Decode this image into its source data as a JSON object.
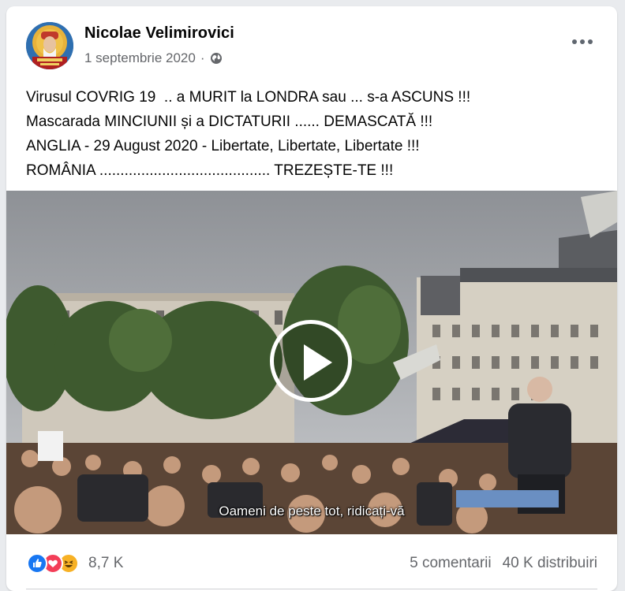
{
  "post": {
    "author": "Nicolae Velimirovici",
    "date": "1 septembrie 2020",
    "separator": "·",
    "privacy_icon": "globe-icon",
    "more_icon": "more-options-icon",
    "lines": [
      "Virusul COVRIG 19  .. a MURIT la LONDRA sau ... s-a ASCUNS !!!",
      "Mascarada MINCIUNII și a DICTATURII ...... DEMASCATĂ !!!",
      "ANGLIA - 29 August 2020 - Libertate, Libertate, Libertate !!!",
      "ROMÂNIA ......................................... TREZEȘTE-TE !!!"
    ]
  },
  "video": {
    "caption": "Oameni de peste tot, ridicați-vă",
    "play_icon": "play-icon"
  },
  "footer": {
    "reaction_icons": [
      "like-icon",
      "love-icon",
      "haha-icon"
    ],
    "reaction_count": "8,7 K",
    "comments": "5 comentarii",
    "shares": "40 K distribuiri"
  },
  "colors": {
    "like": "#1877f2",
    "love": "#f33e58",
    "haha": "#f7b125",
    "secondary_text": "#65676b"
  }
}
